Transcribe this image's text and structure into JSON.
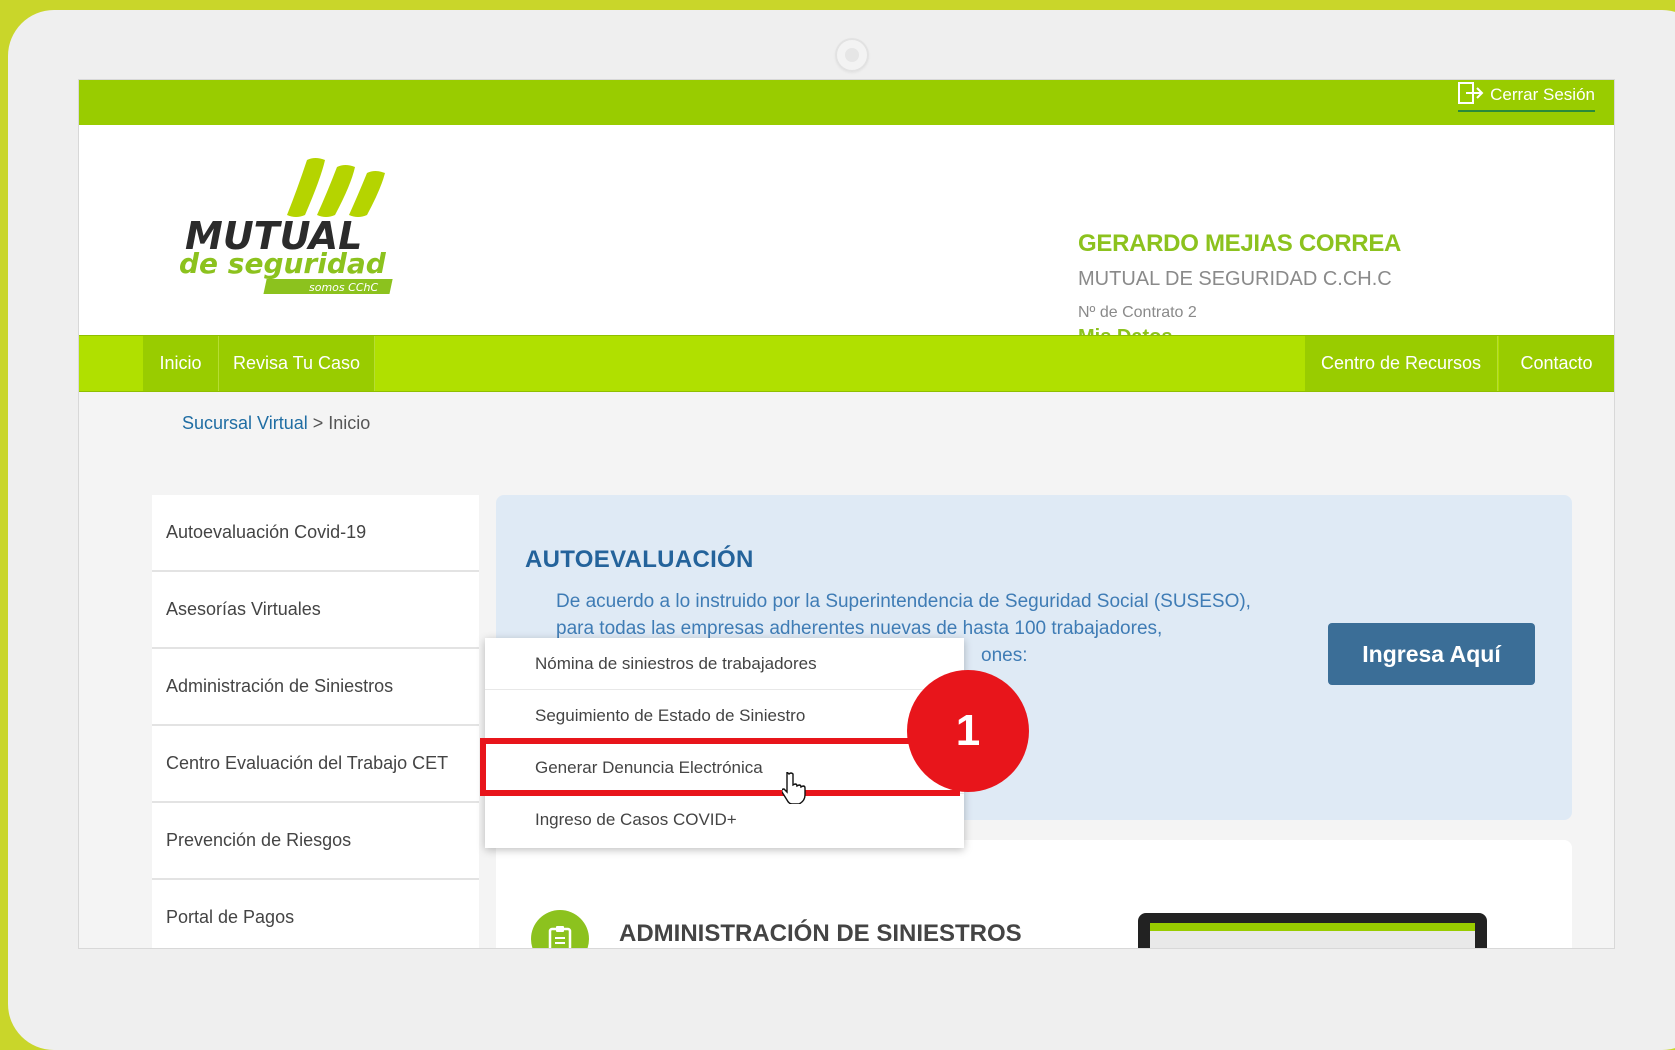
{
  "topbar": {
    "logout_label": "Cerrar Sesión"
  },
  "header": {
    "logo": {
      "word1": "MUTUAL",
      "word2": "de seguridad",
      "tag": "somos CChC"
    },
    "user_name": "GERARDO MEJIAS CORREA",
    "company": "MUTUAL DE SEGURIDAD C.CH.C",
    "contract": "Nº de Contrato 2",
    "my_data_link": "Mis Datos"
  },
  "nav": {
    "left": [
      "Inicio",
      "Revisa Tu Caso"
    ],
    "right": [
      "Centro de Recursos",
      "Contacto"
    ]
  },
  "breadcrumb": {
    "root": "Sucursal Virtual",
    "current": "> Inicio"
  },
  "sidebar": {
    "items": [
      "Autoevaluación Covid-19",
      "Asesorías Virtuales",
      "Administración de Siniestros",
      "Centro Evaluación del Trabajo CET",
      "Prevención de Riesgos",
      "Portal de Pagos"
    ]
  },
  "panel": {
    "title": "AUTOEVALUACIÓN",
    "line1": "De acuerdo a lo instruido por la Superintendencia de Seguridad Social (SUSESO),",
    "line2": "para todas las empresas adherentes nuevas de hasta 100 trabajadores,",
    "line3": "ones:",
    "button": "Ingresa Aquí"
  },
  "dropdown": {
    "items": [
      "Nómina de siniestros de trabajadores",
      "Seguimiento de Estado de Siniestro",
      "Generar Denuncia Electrónica",
      "Ingreso de Casos COVID+"
    ]
  },
  "lower_section": {
    "title": "ADMINISTRACIÓN DE SINIESTROS"
  },
  "annotation": {
    "step_number": "1",
    "color": "#e8151b"
  },
  "colors": {
    "brand_green": "#99cc00",
    "nav_green": "#b0e000",
    "title_blue": "#24639b",
    "button_blue": "#3b6e97"
  }
}
